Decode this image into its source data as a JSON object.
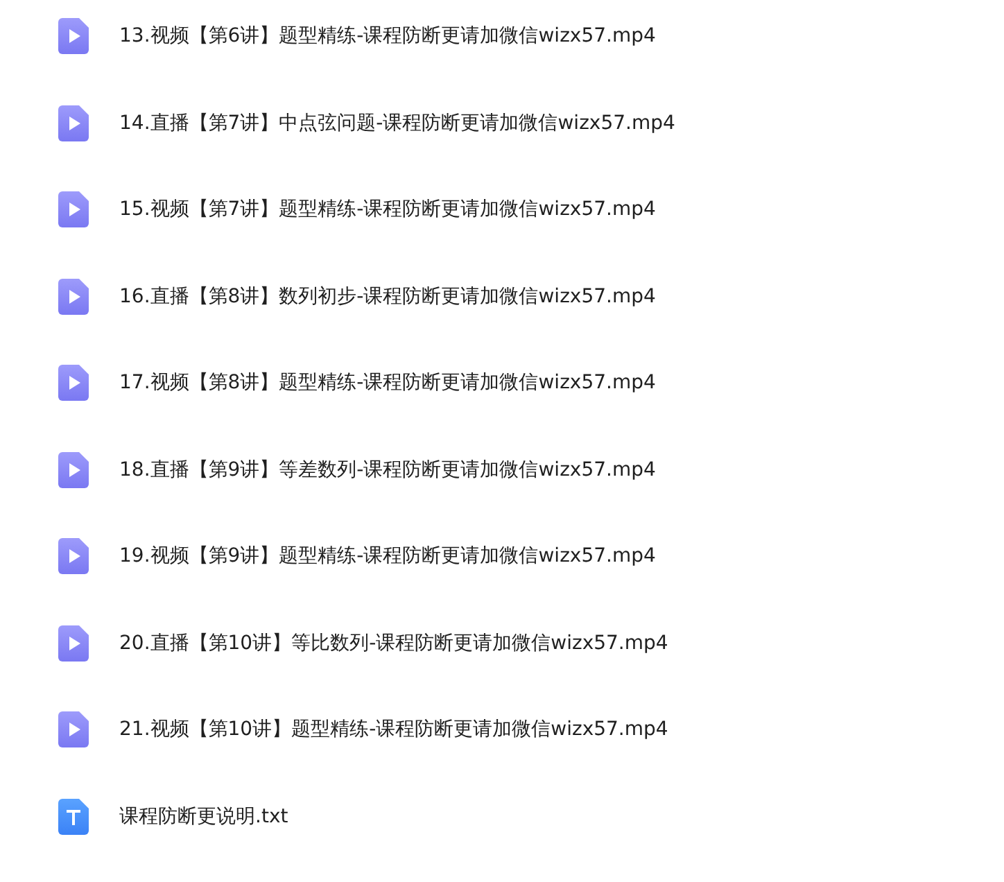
{
  "files": [
    {
      "kind": "video",
      "name": "13.视频【第6讲】题型精练-课程防断更请加微信wizx57.mp4"
    },
    {
      "kind": "video",
      "name": "14.直播【第7讲】中点弦问题-课程防断更请加微信wizx57.mp4"
    },
    {
      "kind": "video",
      "name": "15.视频【第7讲】题型精练-课程防断更请加微信wizx57.mp4"
    },
    {
      "kind": "video",
      "name": "16.直播【第8讲】数列初步-课程防断更请加微信wizx57.mp4"
    },
    {
      "kind": "video",
      "name": "17.视频【第8讲】题型精练-课程防断更请加微信wizx57.mp4"
    },
    {
      "kind": "video",
      "name": "18.直播【第9讲】等差数列-课程防断更请加微信wizx57.mp4"
    },
    {
      "kind": "video",
      "name": "19.视频【第9讲】题型精练-课程防断更请加微信wizx57.mp4"
    },
    {
      "kind": "video",
      "name": "20.直播【第10讲】等比数列-课程防断更请加微信wizx57.mp4"
    },
    {
      "kind": "video",
      "name": "21.视频【第10讲】题型精练-课程防断更请加微信wizx57.mp4"
    },
    {
      "kind": "text",
      "name": "课程防断更说明.txt"
    }
  ]
}
